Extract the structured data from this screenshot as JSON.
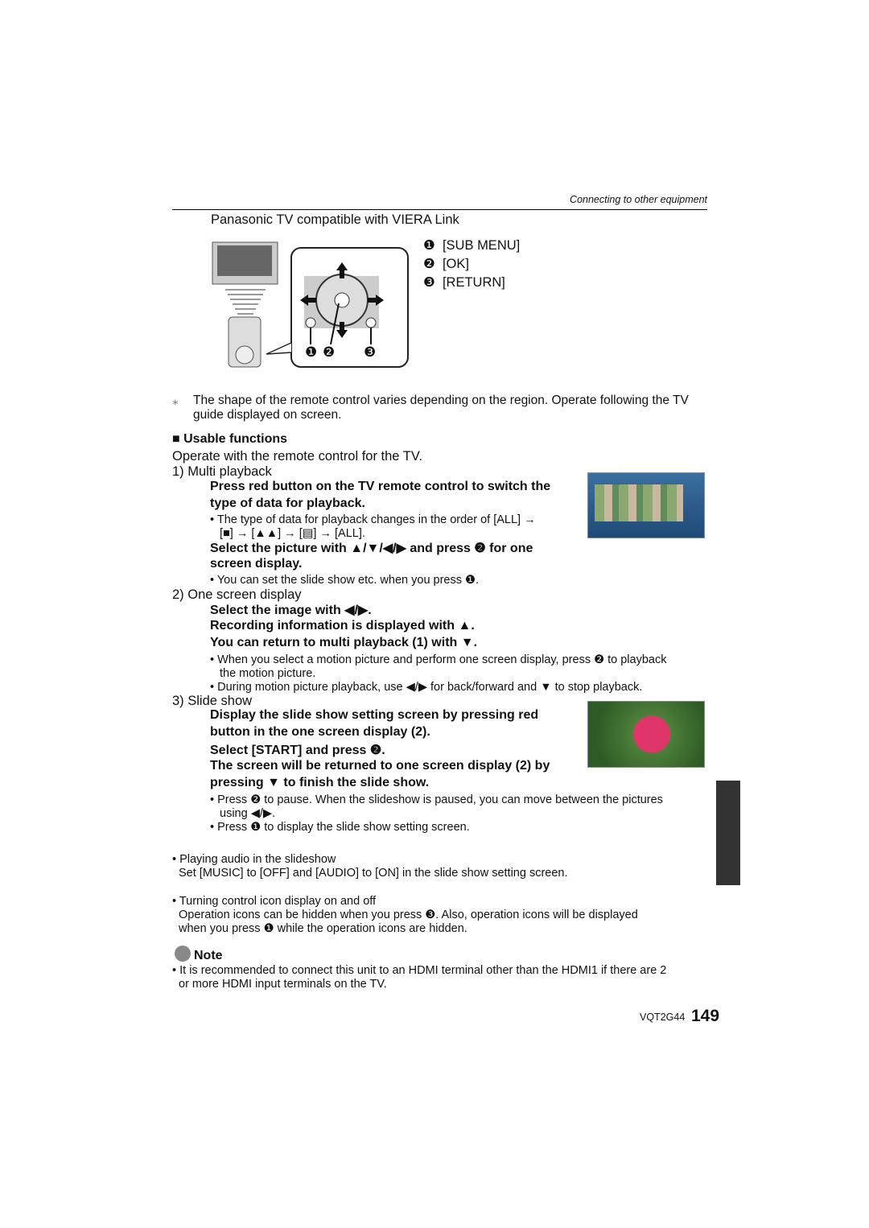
{
  "header": {
    "section": "Connecting to other equipment"
  },
  "intro_title": "Panasonic TV compatible with VIERA Link",
  "legend": [
    {
      "num": "❶",
      "label": "[SUB MENU]"
    },
    {
      "num": "❷",
      "label": "[OK]"
    },
    {
      "num": "❸",
      "label": "[RETURN]"
    }
  ],
  "figure": {
    "callouts": [
      "❶",
      "❷",
      "❸"
    ]
  },
  "footnote": {
    "mark": "⁎",
    "lines": [
      "The shape of the remote control varies depending on the region. Operate following the TV",
      "guide displayed on screen."
    ]
  },
  "usable": {
    "heading": "■ Usable functions",
    "intro": "Operate with the remote control for the TV.",
    "multi": {
      "title": "1) Multi playback",
      "step1": [
        "Press red button on the TV remote control to switch the",
        "type of data for playback."
      ],
      "bullet1": [
        "• The type of data for playback changes in the order of [ALL] →",
        "[■] → [▲▲] → [▤] → [ALL]."
      ],
      "step2": [
        "Select the picture with ▲/▼/◀/▶ and press ❷ for one",
        "screen display."
      ],
      "bullet2": "• You can set the slide show etc. when you press ❶."
    },
    "one": {
      "title": "2) One screen display",
      "steps": [
        "Select the image with ◀/▶.",
        "Recording information is displayed with ▲.",
        "You can return to multi playback (1) with ▼."
      ],
      "bullets": [
        "• When you select a motion picture and perform one screen display, press ❷ to playback",
        "the motion picture.",
        "• During motion picture playback, use ◀/▶ for back/forward and ▼ to stop playback."
      ]
    },
    "slide": {
      "title": "3) Slide show",
      "steps": [
        "Display the slide show setting screen by pressing red",
        "button in the one screen display (2).",
        "Select [START] and press ❷.",
        "The screen will be returned to one screen display (2) by",
        "pressing ▼ to finish the slide show."
      ],
      "bullets": [
        "• Press ❷ to pause. When the slideshow is paused, you can move between the pictures",
        "using ◀/▶.",
        "• Press ❶ to display the slide show setting screen."
      ]
    }
  },
  "audio": {
    "title": "• Playing audio in the slideshow",
    "body": "Set [MUSIC] to [OFF] and [AUDIO] to [ON] in the slide show setting screen."
  },
  "icons": {
    "title": "• Turning control icon display on and off",
    "body": [
      "Operation icons can be hidden when you press ❸. Also, operation icons will be displayed",
      "when you press ❶ while the operation icons are hidden."
    ]
  },
  "note": {
    "label": "Note",
    "lines": [
      "• It is recommended to connect this unit to an HDMI terminal other than the HDMI1 if there are 2",
      "or more HDMI input terminals on the TV."
    ]
  },
  "footer": {
    "code": "VQT2G44",
    "page": "149"
  },
  "colors": {
    "side_tab": "#333333",
    "screen_bg": "#2a5a8a",
    "flower": "#e0356a"
  }
}
